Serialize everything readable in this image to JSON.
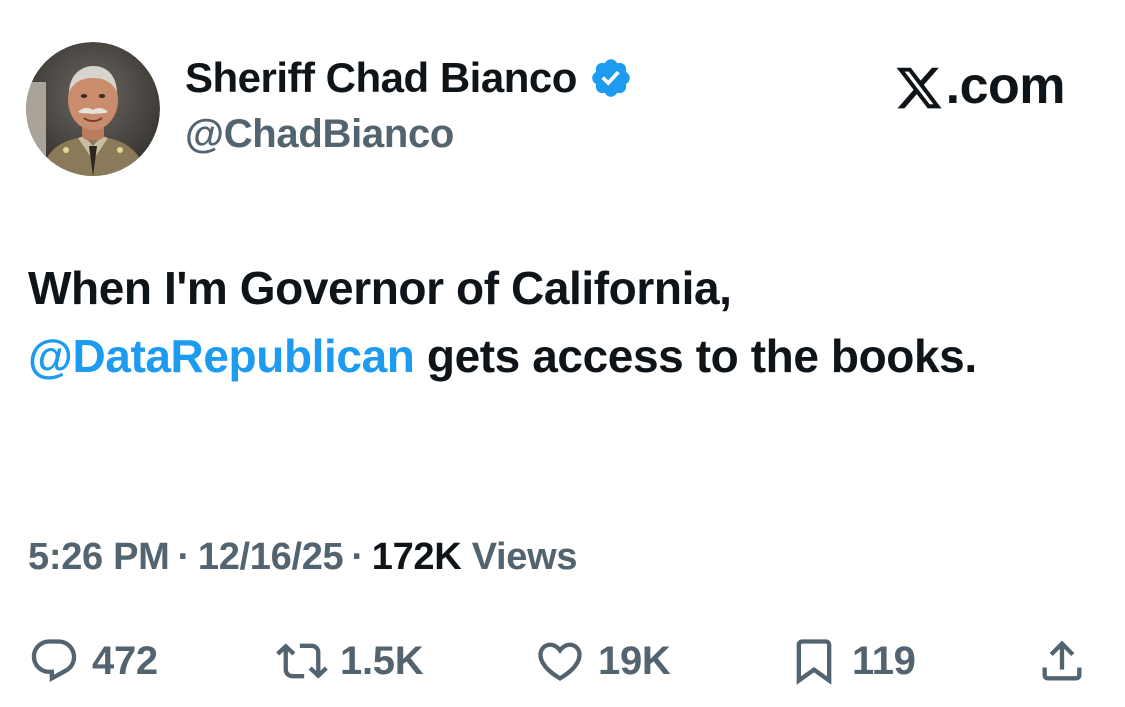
{
  "author": {
    "display_name": "Sheriff Chad Bianco",
    "handle": "@ChadBianco",
    "verified_icon": "verified-badge-icon",
    "avatar": "avatar"
  },
  "brand": {
    "logo_icon": "x-logo-icon",
    "suffix": ".com"
  },
  "tweet": {
    "text_before": "When I'm Governor of California, ",
    "mention": "@DataRepublican",
    "text_after": " gets access to the books."
  },
  "meta": {
    "time": "5:26 PM",
    "separator": "·",
    "date": "12/16/25",
    "views_count": "172K",
    "views_label": "Views"
  },
  "actions": {
    "reply": {
      "icon": "reply-icon",
      "count": "472"
    },
    "retweet": {
      "icon": "retweet-icon",
      "count": "1.5K"
    },
    "like": {
      "icon": "heart-icon",
      "count": "19K"
    },
    "bookmark": {
      "icon": "bookmark-icon",
      "count": "119"
    },
    "share": {
      "icon": "share-icon"
    }
  },
  "colors": {
    "text_primary": "#0f1419",
    "text_secondary": "#536471",
    "accent": "#1d9bf0",
    "background": "#ffffff"
  }
}
